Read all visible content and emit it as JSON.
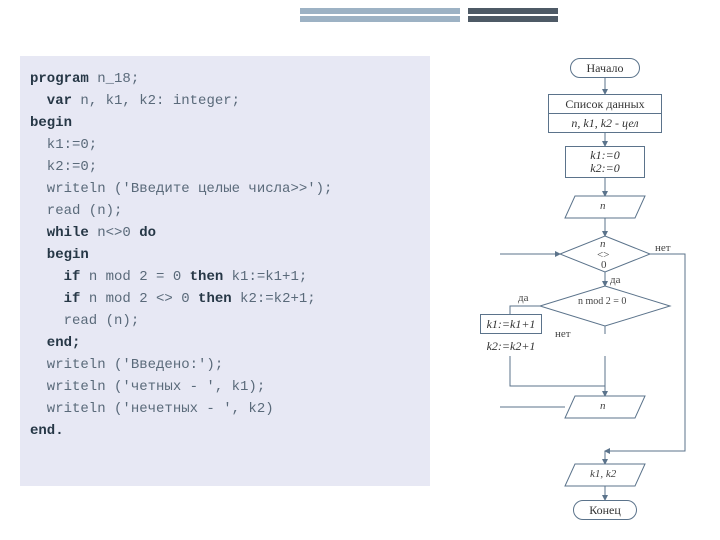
{
  "code": {
    "l1a": "program",
    "l1b": " n_18;",
    "l2a": "  var",
    "l2b": " n, k1, k2: integer;",
    "l3": "begin",
    "l4": "  k1:=0;",
    "l5": "  k2:=0;",
    "l6": "  writeln ('Введите целые числа>>');",
    "l7": "  read (n);",
    "l8a": "  while",
    "l8b": " n<>0 ",
    "l8c": "do",
    "l9": "  begin",
    "l10a": "    if",
    "l10b": " n mod 2 = 0 ",
    "l10c": "then",
    "l10d": " k1:=k1+1;",
    "l11a": "    if",
    "l11b": " n mod 2 <> 0 ",
    "l11c": "then",
    "l11d": " k2:=k2+1;",
    "l12": "    read (n);",
    "l13": "  end;",
    "l14": "  writeln ('Введено:');",
    "l15": "  writeln ('четных - ', k1);",
    "l16": "  writeln ('нечетных - ', k2)",
    "l17": "end."
  },
  "flow": {
    "start": "Начало",
    "datalist": "Список данных",
    "decl": "n, k1, k2 - цел",
    "init1": "k1:=0",
    "init2": "k2:=0",
    "read_n": "n",
    "cond1a": "n",
    "cond1b": "<>",
    "cond1c": "0",
    "yes": "да",
    "no": "нет",
    "cond2": "n mod 2 = 0",
    "assign1": "k1:=k1+1",
    "assign2": "k2:=k2+1",
    "read_n2": "n",
    "output": "k1, k2",
    "end": "Конец"
  }
}
